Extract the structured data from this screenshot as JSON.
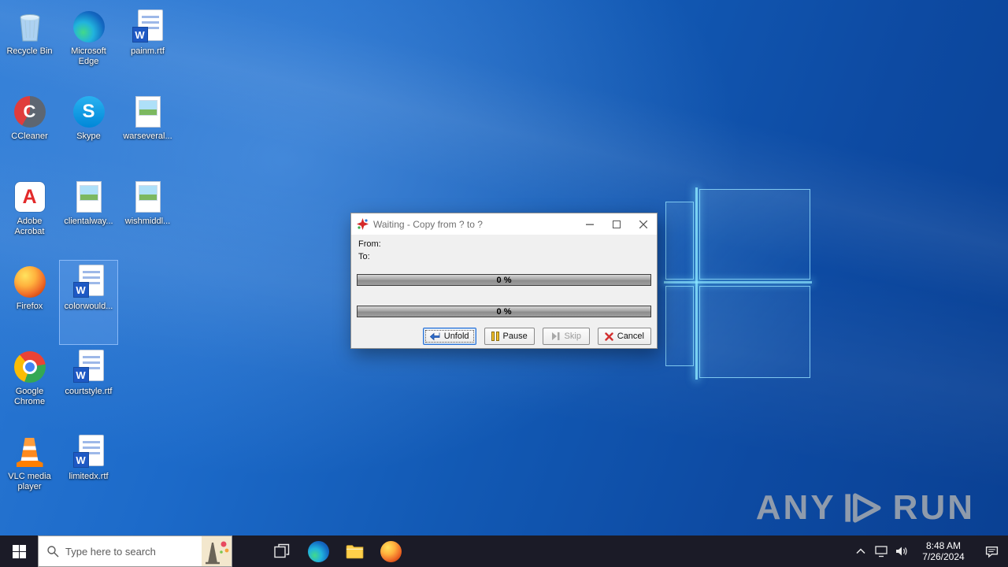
{
  "theme": {
    "taskbar": "#1b1b27",
    "selection": "#629ee8",
    "wallpaper_blue": "#1259b4"
  },
  "desktop": {
    "icons": [
      {
        "label": "Recycle Bin",
        "type": "recycle-bin"
      },
      {
        "label": "CCleaner",
        "type": "ccleaner"
      },
      {
        "label": "Adobe Acrobat",
        "type": "acrobat"
      },
      {
        "label": "Firefox",
        "type": "firefox"
      },
      {
        "label": "Google Chrome",
        "type": "chrome"
      },
      {
        "label": "VLC media player",
        "type": "vlc"
      },
      {
        "label": "Microsoft Edge",
        "type": "edge"
      },
      {
        "label": "Skype",
        "type": "skype"
      },
      {
        "label": "clientalway...",
        "type": "image"
      },
      {
        "label": "colorwould...",
        "type": "word",
        "selected": true
      },
      {
        "label": "courtstyle.rtf",
        "type": "word"
      },
      {
        "label": "limitedx.rtf",
        "type": "word"
      },
      {
        "label": "painm.rtf",
        "type": "word"
      },
      {
        "label": "warseveral...",
        "type": "image"
      },
      {
        "label": "wishmiddl...",
        "type": "image"
      }
    ]
  },
  "dialog": {
    "title": "Waiting - Copy from ? to ?",
    "fields": {
      "from": "From:",
      "to": "To:"
    },
    "progress": {
      "top": "0 %",
      "bottom": "0 %"
    },
    "buttons": {
      "unfold": "Unfold",
      "pause": "Pause",
      "skip": "Skip",
      "cancel": "Cancel"
    }
  },
  "taskbar": {
    "search": {
      "placeholder": "Type here to search"
    },
    "clock": {
      "time": "8:48 AM",
      "date": "7/26/2024"
    }
  },
  "watermark": {
    "any": "ANY",
    "run": "RUN"
  }
}
